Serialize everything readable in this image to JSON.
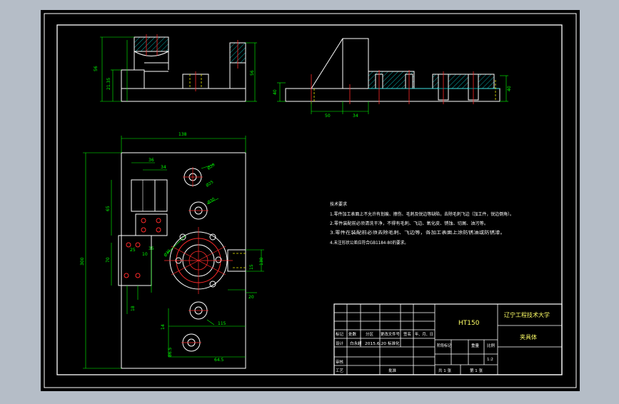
{
  "colors": {
    "background": "#b5bdc7",
    "sheet": "#000000",
    "line": "#ffffff",
    "dimension": "#00ff00",
    "hatch": "#00d8d8",
    "center": "#ff2a2a",
    "hidden": "#e8e800",
    "note": "#ffffff",
    "title_text": "#ffff66"
  },
  "front_view": {
    "dim_height_total": "56",
    "dim_height_base": "21.35",
    "dim_height_right": "56"
  },
  "side_view": {
    "dim_left": "40",
    "dim_right": "40",
    "dim_50": "50",
    "dim_34": "34"
  },
  "top_view": {
    "dim_width": "138",
    "dim_height": "300",
    "dim_36": "36",
    "dim_34": "34",
    "dim_65": "65",
    "dim_70": "70",
    "dim_25": "25",
    "dim_18": "18",
    "dim_10": "10",
    "dim_35": "35",
    "dim_115": "115",
    "dim_64_5": "64.5",
    "dim_86_5": "86.5",
    "dim_14": "14",
    "dim_phi1": "Ø20",
    "dim_phi2": "Ø25",
    "dim_phi3": "Ø30",
    "dim_phi4": "Ø30",
    "dim_130": "130",
    "dim_20": "20",
    "dim_15": "15"
  },
  "notes": {
    "title": "技术要求",
    "lines": [
      "1.零件加工表面上不允许有划痕、擦伤、毛刺及锐边等缺陷，去除毛刺飞边（加工件，锐边倒角）。",
      "2.零件装配前必须清洗干净，不得有毛刺、飞边、氧化皮、锈蚀、切屑、油污等。",
      "3.零件在装配前必须去除毛刺、飞边等，各加工表面上涂防锈油或防锈漆。",
      "4.未注形状公差应符合GB1184-80的要求。"
    ]
  },
  "title_block": {
    "drawing_no": "HT150",
    "school": "辽宁工程技术大学",
    "drawing_name": "夹具体",
    "mark_label": "标记",
    "count_label": "处数",
    "zone_label": "分区",
    "change_label": "更改文件号",
    "sign_label": "签名",
    "date_label": "年、月、日",
    "design_label": "设计",
    "designer": "白永超",
    "design_date": "2015.6.20",
    "std_label": "标准化",
    "review_label": "审核",
    "process_label": "工艺",
    "approve_label": "批准",
    "stage_label": "阶段标记",
    "weight_label": "重量",
    "scale_label": "比例",
    "scale": "1:2",
    "sheets_total": "共 1 张",
    "sheet_no": "第 1 张"
  }
}
